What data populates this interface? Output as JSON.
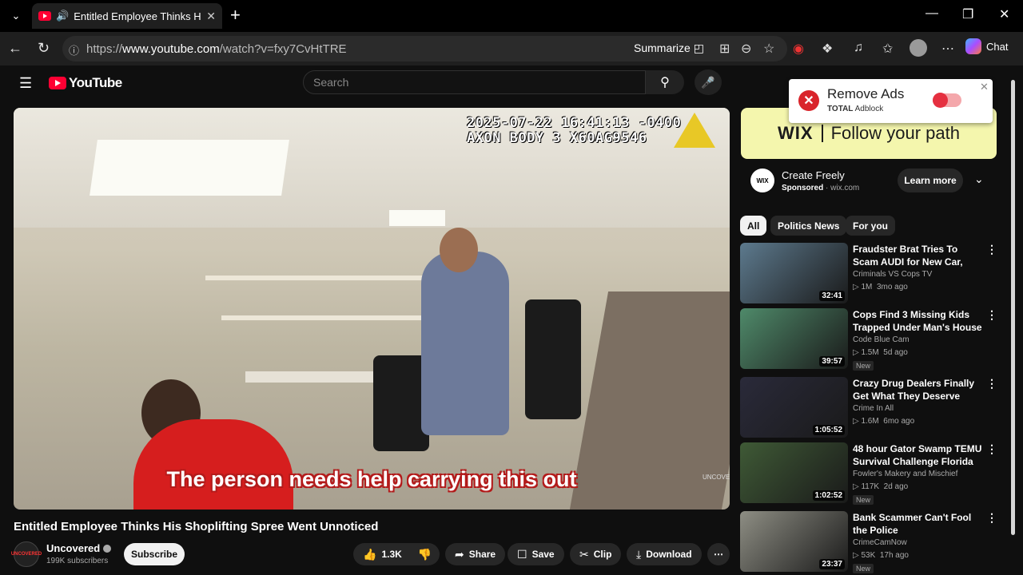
{
  "browser": {
    "tab_title": "Entitled Employee Thinks His Shoplifting Spree Went Unnoticed",
    "url_prefix": "https://",
    "url_host": "www.youtube.com",
    "url_path": "/watch?v=fxy7CvHtTRE",
    "summarize_label": "Summarize",
    "chat_label": "Chat"
  },
  "youtube": {
    "logo_text": "YouTube",
    "search_placeholder": "Search"
  },
  "video": {
    "timestamp": "2025-07-22 16:41:13 -0400",
    "device": "AXON BODY 3 X60AG9546",
    "caption": "The person needs help carrying this out",
    "watermark": "UNCOVERED",
    "title": "Entitled Employee Thinks His Shoplifting Spree Went Unnoticed",
    "channel": "Uncovered",
    "subscribers": "199K subscribers",
    "subscribe_label": "Subscribe",
    "likes": "1.3K",
    "share_label": "Share",
    "save_label": "Save",
    "clip_label": "Clip",
    "download_label": "Download"
  },
  "ad": {
    "banner_brand": "WIX",
    "banner_text": "Follow your path",
    "title": "Create Freely",
    "sponsored": "Sponsored",
    "domain": "wix.com",
    "cta": "Learn more"
  },
  "chips": [
    "All",
    "Politics News",
    "For you"
  ],
  "recommendations": [
    {
      "title": "Fraudster Brat Tries To Scam AUDI for New Car, Thinks She ...",
      "channel": "Criminals VS Cops TV",
      "views": "1M",
      "age": "3mo ago",
      "duration": "32:41",
      "badge": "",
      "thumb_color": "#5d7a8e"
    },
    {
      "title": "Cops Find 3 Missing Kids Trapped Under Man's House",
      "channel": "Code Blue Cam",
      "views": "1.5M",
      "age": "5d ago",
      "duration": "39:57",
      "badge": "New",
      "thumb_color": "#4f8a6a"
    },
    {
      "title": "Crazy Drug Dealers Finally Get What They Deserve",
      "channel": "Crime In All",
      "views": "1.6M",
      "age": "6mo ago",
      "duration": "1:05:52",
      "badge": "",
      "thumb_color": "#2a2a3a"
    },
    {
      "title": "48 hour Gator Swamp TEMU Survival Challenge Florida",
      "channel": "Fowler's Makery and Mischief",
      "views": "117K",
      "age": "2d ago",
      "duration": "1:02:52",
      "badge": "New",
      "thumb_color": "#3f5a36"
    },
    {
      "title": "Bank Scammer Can't Fool the Police",
      "channel": "CrimeCamNow",
      "views": "53K",
      "age": "17h ago",
      "duration": "23:37",
      "badge": "New",
      "thumb_color": "#8e8e84"
    }
  ],
  "adblock": {
    "title": "Remove Ads",
    "brand_bold": "TOTAL",
    "brand_rest": " Adblock"
  }
}
